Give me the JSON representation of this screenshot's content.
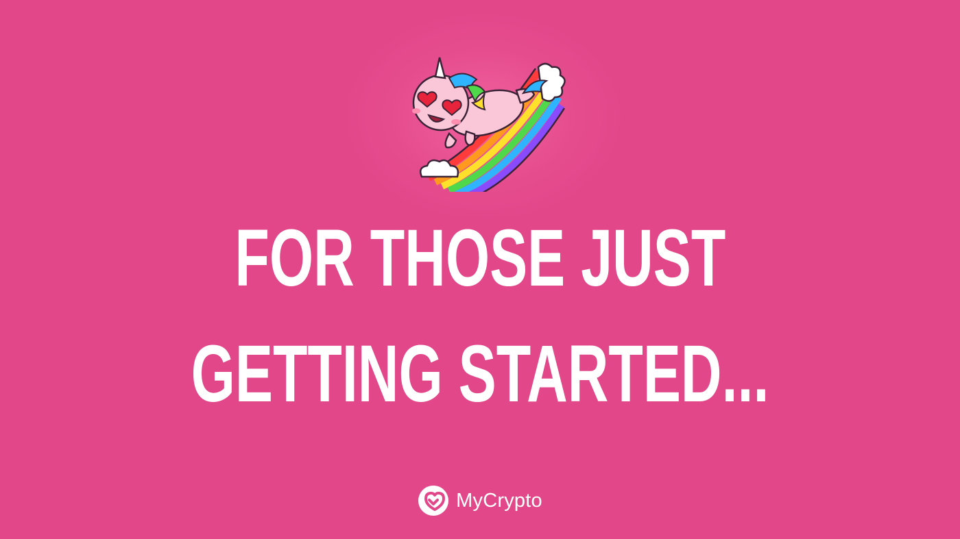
{
  "headline": {
    "line1": "FOR THOSE JUST",
    "line2": "GETTING STARTED..."
  },
  "illustration": {
    "icon": "unicorn-on-rainbow-icon"
  },
  "brand": {
    "logo_icon": "mycrypto-logo-icon",
    "name": "MyCrypto"
  },
  "colors": {
    "background": "#e2478a",
    "text": "#ffffff"
  }
}
